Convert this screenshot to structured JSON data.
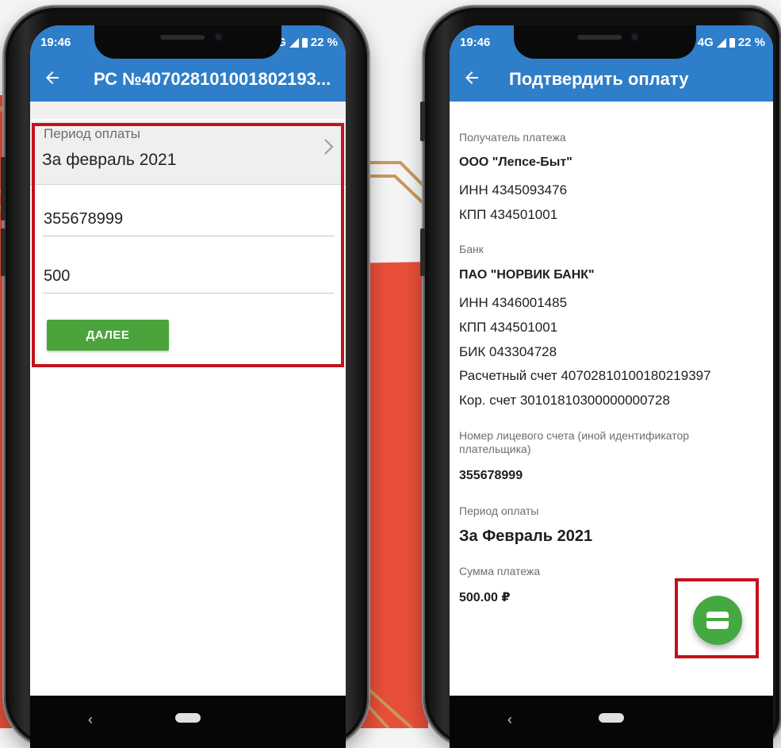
{
  "colors": {
    "primary": "#2f7ec9",
    "accent_green": "#44a940",
    "highlight_red": "#c4111d",
    "background_coral": "#e84f39",
    "decor_gold": "#c9985c"
  },
  "left_phone": {
    "status_bar": {
      "time": "19:46",
      "network": "G",
      "battery": "22 %"
    },
    "app_bar": {
      "back_icon": "arrow-left-icon",
      "title": "РС №407028101001802193..."
    },
    "form": {
      "period_label": "Период оплаты",
      "period_value": "За февраль 2021",
      "account_number_value": "355678999",
      "amount_value": "500",
      "next_button_label": "ДАЛЕЕ"
    },
    "nav": {
      "back_icon": "nav-back-icon",
      "home_icon": "home-pill-icon",
      "back_glyph": "‹"
    }
  },
  "right_phone": {
    "status_bar": {
      "time": "19:46",
      "network": "4G",
      "battery": "22 %"
    },
    "app_bar": {
      "back_icon": "arrow-left-icon",
      "title": "Подтвердить оплату"
    },
    "recipient": {
      "label": "Получатель платежа",
      "name": "ООО \"Лепсе-Быт\"",
      "inn": "ИНН 4345093476",
      "kpp": "КПП 434501001"
    },
    "bank": {
      "label": "Банк",
      "name": "ПАО \"НОРВИК БАНК\"",
      "inn": "ИНН 4346001485",
      "kpp": "КПП 434501001",
      "bik": "БИК 043304728",
      "settlement_account": "Расчетный счет 40702810100180219397",
      "correspondent_account": "Кор. счет 30101810300000000728"
    },
    "payer": {
      "label_line1": "Номер лицевого счета (иной идентификатор",
      "label_line2": "плательщика)",
      "value": "355678999"
    },
    "period": {
      "label": "Период оплаты",
      "value": "За Февраль 2021"
    },
    "amount": {
      "label": "Сумма платежа",
      "value": "500.00 ₽"
    },
    "fab_icon": "credit-card-icon",
    "nav": {
      "back_icon": "nav-back-icon",
      "home_icon": "home-pill-icon",
      "back_glyph": "‹"
    }
  }
}
